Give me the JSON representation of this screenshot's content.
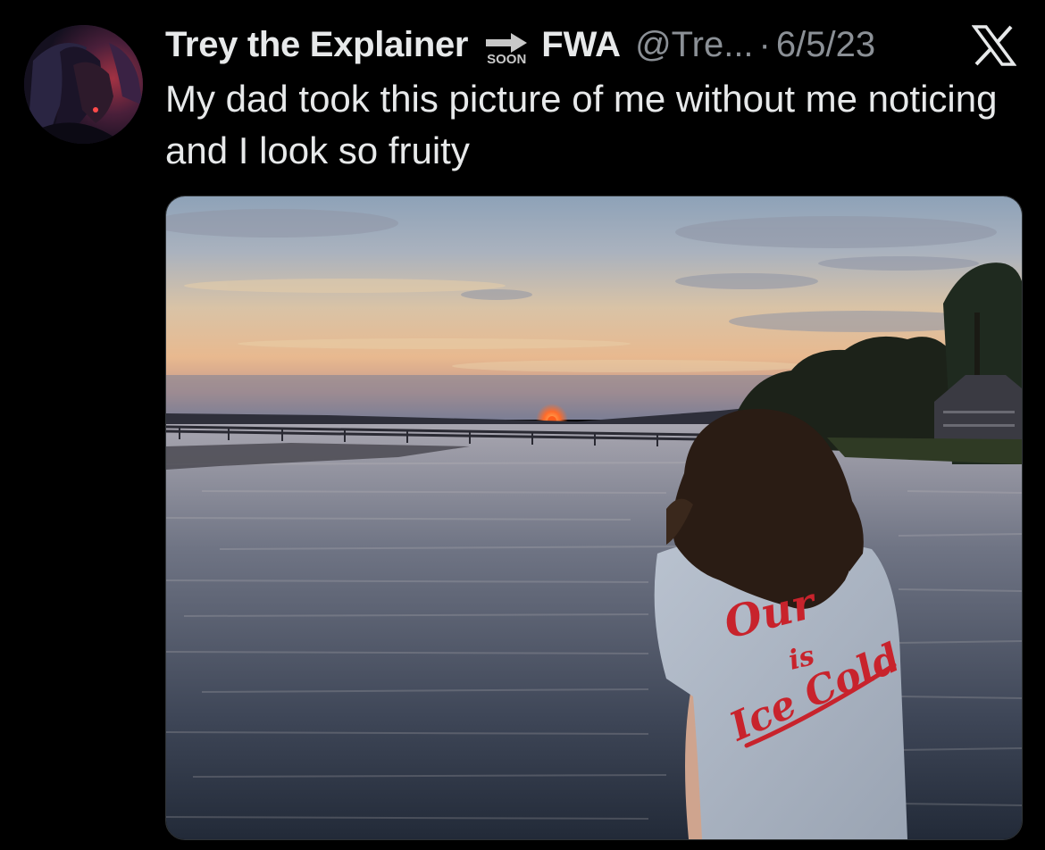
{
  "tweet": {
    "author": {
      "display_name": "Trey the Explainer",
      "name_emoji": "soon-arrow-icon",
      "name_emoji_text": "SOON",
      "name_suffix": "FWA",
      "handle": "@Tre...",
      "separator": "·",
      "date": "6/5/23"
    },
    "text": "My dad took this picture of me without me noticing and I look so fruity",
    "media": {
      "type": "photo",
      "shirt_text_line1": "Our",
      "shirt_text_line2": "is",
      "shirt_text_line3": "Ice Cold"
    },
    "platform_icon": "x-logo-icon"
  },
  "colors": {
    "background": "#000000",
    "text_primary": "#e7e9ea",
    "text_secondary": "#8b9096",
    "shirt_script_red": "#c8232c"
  }
}
